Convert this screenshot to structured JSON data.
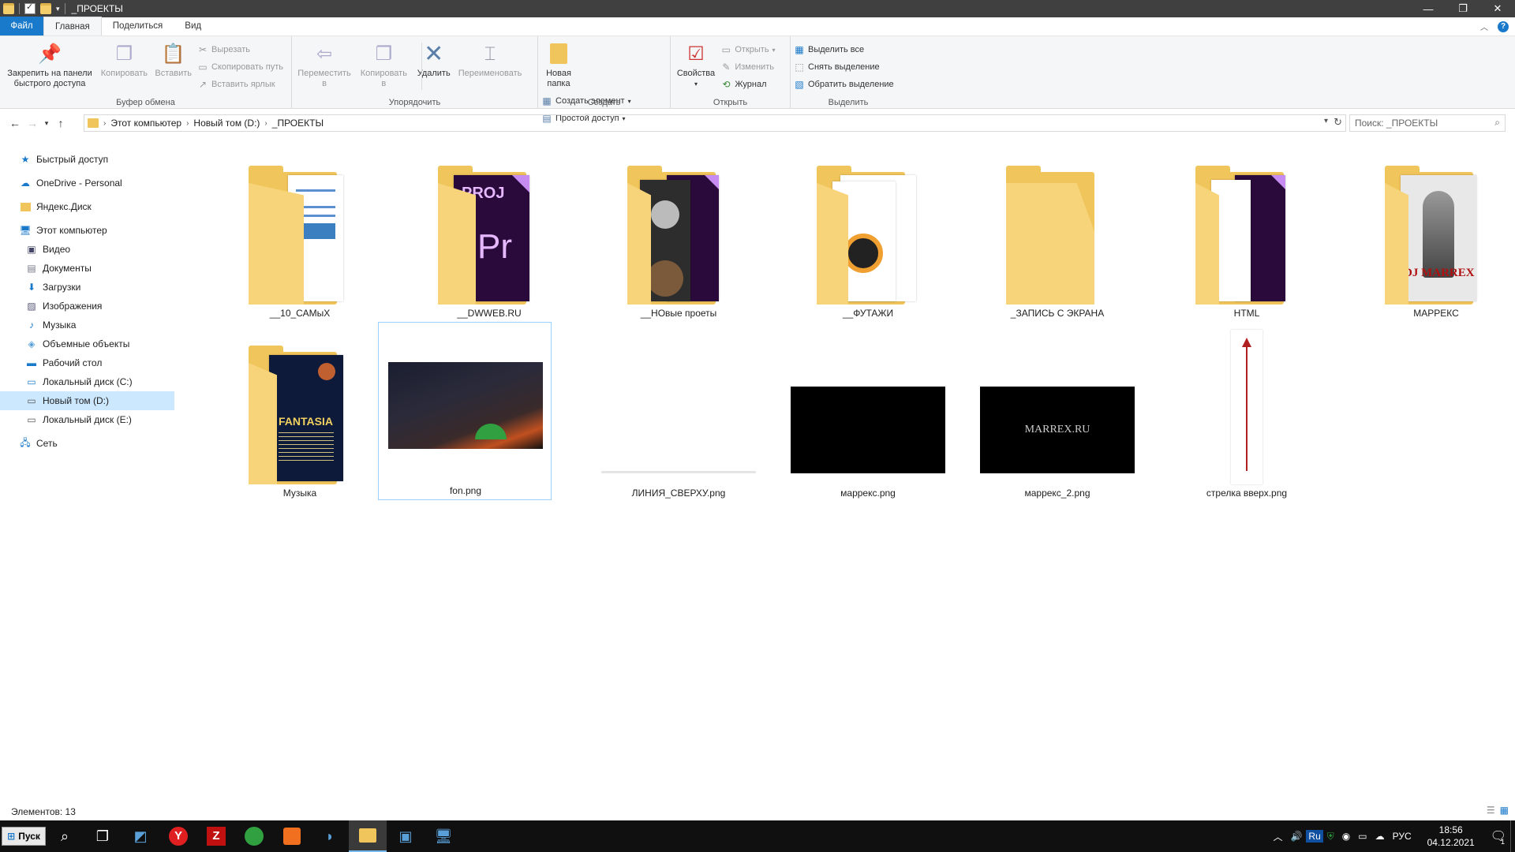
{
  "window": {
    "title": "_ПРОЕКТЫ"
  },
  "tabs": [
    {
      "label": "Файл"
    },
    {
      "label": "Главная"
    },
    {
      "label": "Поделиться"
    },
    {
      "label": "Вид"
    }
  ],
  "ribbon": {
    "clipboard": {
      "label": "Буфер обмена",
      "pin": "Закрепить на панели быстрого доступа",
      "copy": "Копировать",
      "paste": "Вставить",
      "cut": "Вырезать",
      "copy_path": "Скопировать путь",
      "paste_shortcut": "Вставить ярлык"
    },
    "organize": {
      "label": "Упорядочить",
      "move": "Переместить в",
      "copy_to": "Копировать в",
      "delete": "Удалить",
      "rename": "Переименовать"
    },
    "create": {
      "label": "Создать",
      "new_folder": "Новая папка",
      "new_item": "Создать элемент",
      "easy_access": "Простой доступ"
    },
    "open": {
      "label": "Открыть",
      "properties": "Свойства",
      "open": "Открыть",
      "edit": "Изменить",
      "history": "Журнал"
    },
    "select": {
      "label": "Выделить",
      "select_all": "Выделить все",
      "select_none": "Снять выделение",
      "invert": "Обратить выделение"
    }
  },
  "address": {
    "crumbs": [
      "Этот компьютер",
      "Новый том (D:)",
      "_ПРОЕКТЫ"
    ],
    "search_placeholder": "Поиск: _ПРОЕКТЫ"
  },
  "nav": {
    "quick_access": "Быстрый доступ",
    "onedrive": "OneDrive - Personal",
    "yandex": "Яндекс.Диск",
    "this_pc": "Этот компьютер",
    "pc_items": [
      "Видео",
      "Документы",
      "Загрузки",
      "Изображения",
      "Музыка",
      "Объемные объекты",
      "Рабочий стол",
      "Локальный диск (C:)",
      "Новый том (D:)",
      "Локальный диск (E:)"
    ],
    "network": "Сеть"
  },
  "items": [
    {
      "name": "__10_САМыХ",
      "type": "folder"
    },
    {
      "name": "__DWWEB.RU",
      "type": "folder"
    },
    {
      "name": "__НОвые проеты",
      "type": "folder"
    },
    {
      "name": "__ФУТАЖИ",
      "type": "folder"
    },
    {
      "name": "_ЗАПИСЬ С ЭКРАНА",
      "type": "folder"
    },
    {
      "name": "HTML",
      "type": "folder"
    },
    {
      "name": "МАРРЕКС",
      "type": "folder"
    },
    {
      "name": "Музыка",
      "type": "folder"
    },
    {
      "name": "fon.png",
      "type": "image"
    },
    {
      "name": "ЛИНИЯ_СВЕРХУ.png",
      "type": "image"
    },
    {
      "name": "маррекс.png",
      "type": "image"
    },
    {
      "name": "маррекс_2.png",
      "type": "image"
    },
    {
      "name": "стрелка вверх.png",
      "type": "image"
    }
  ],
  "thumb_text": {
    "proj": "PROJ",
    "pr": "Pr",
    "marrex": "DJ MARREX",
    "fantasia": "FANTASIA",
    "marrex_ru": "MARREX.RU"
  },
  "status": {
    "count": "Элементов: 13"
  },
  "taskbar": {
    "start": "Пуск",
    "lang": "РУС",
    "ru": "Ru",
    "time": "18:56",
    "date": "04.12.2021",
    "notif": "1"
  }
}
